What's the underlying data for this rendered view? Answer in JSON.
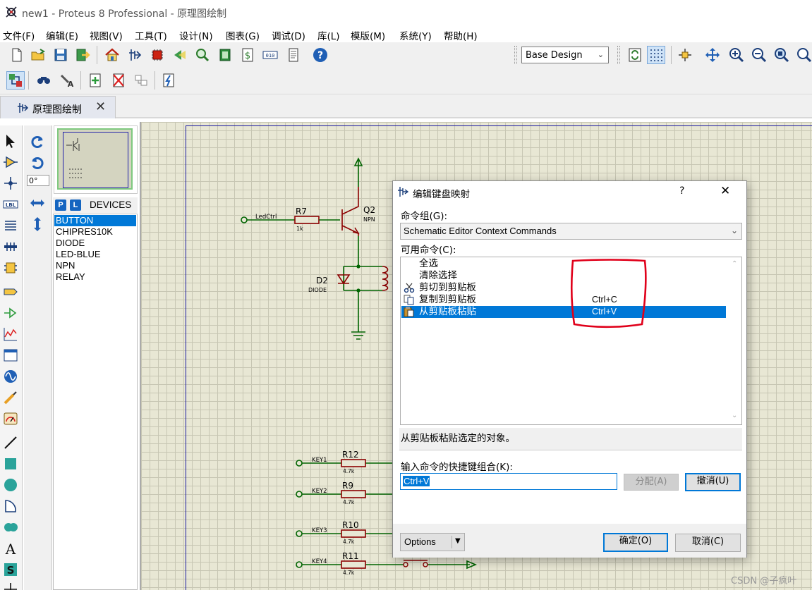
{
  "window": {
    "title": "new1 - Proteus 8 Professional - 原理图绘制",
    "app_icon": "proteus-icon"
  },
  "menubar": {
    "items": [
      "文件(F)",
      "编辑(E)",
      "视图(V)",
      "工具(T)",
      "设计(N)",
      "图表(G)",
      "调试(D)",
      "库(L)",
      "模版(M)",
      "系统(Y)",
      "帮助(H)"
    ]
  },
  "toolbar": {
    "layer_select_value": "Base Design"
  },
  "tabs": [
    {
      "label": "原理图绘制",
      "icon": "schematic-icon"
    }
  ],
  "rotation": {
    "angle": "0°"
  },
  "devices": {
    "p_label": "P",
    "l_label": "L",
    "title": "DEVICES",
    "items": [
      "BUTTON",
      "CHIPRES10K",
      "DIODE",
      "LED-BLUE",
      "NPN",
      "RELAY"
    ],
    "selected": "BUTTON"
  },
  "schematic": {
    "labels": {
      "ledctrl": "LedCtrl",
      "r7": "R7",
      "r7_val": "1k",
      "q2": "Q2",
      "q2_type": "NPN",
      "d2": "D2",
      "d2_type": "DIODE",
      "key1": "KEY1",
      "r12": "R12",
      "r12_val": "4.7k",
      "key2": "KEY2",
      "r9": "R9",
      "r9_val": "4.7k",
      "key3": "KEY3",
      "r10": "R10",
      "r10_val": "4.7k",
      "key4": "KEY4",
      "r11": "R11",
      "r11_val": "4.7k"
    },
    "colors": {
      "wire": "#006400",
      "component": "#8b0000",
      "text": "#000000",
      "grid_bg": "#e8e7d4"
    }
  },
  "dialog": {
    "title": "编辑键盘映射",
    "help": "?",
    "close": "✕",
    "command_group_label": "命令组(G):",
    "command_group_value": "Schematic Editor Context Commands",
    "available_label": "可用命令(C):",
    "commands": [
      {
        "name": "全选",
        "key": "",
        "icon": ""
      },
      {
        "name": "清除选择",
        "key": "",
        "icon": ""
      },
      {
        "name": "剪切到剪贴板",
        "key": "",
        "icon": "scissors-icon"
      },
      {
        "name": "复制到剪贴板",
        "key": "Ctrl+C",
        "icon": "copy-icon"
      },
      {
        "name": "从剪贴板粘贴",
        "key": "Ctrl+V",
        "icon": "paste-icon"
      }
    ],
    "selected_command": "从剪贴板粘贴",
    "description": "从剪贴板粘贴选定的对象。",
    "shortcut_label": "输入命令的快捷键组合(K):",
    "shortcut_value": "Ctrl+V",
    "assign_button": "分配(A)",
    "undo_button": "撤消(U)",
    "options_button": "Options",
    "ok_button": "确定(O)",
    "cancel_button": "取消(C)"
  },
  "annotation": {
    "color": "#e0001a"
  },
  "watermark": "CSDN @子疯叶"
}
